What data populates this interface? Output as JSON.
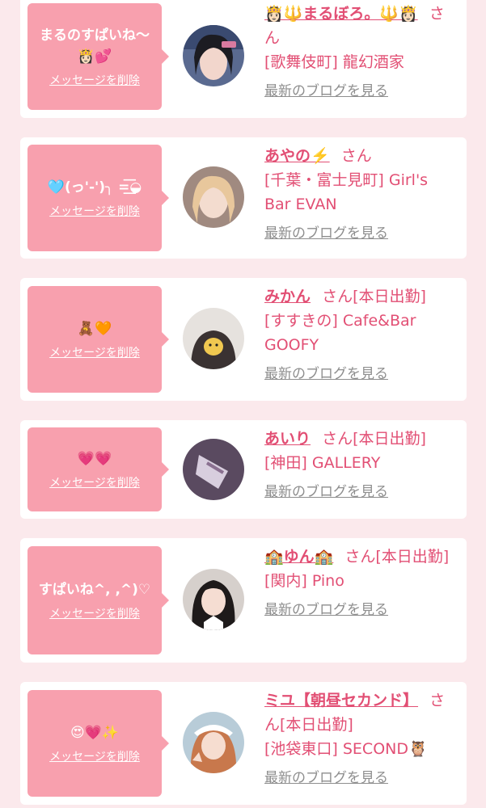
{
  "colors": {
    "page_bg": "#fbe9ec",
    "card_bg": "#ffffff",
    "bubble": "#f8a0ae",
    "accent": "#e24f74",
    "link_gray": "#8e8e8e"
  },
  "delete_label": "メッセージを削除",
  "blog_label": "最新のブログを見る",
  "san_label": "さん",
  "items": [
    {
      "message": "まるのすぱいね〜👸🏻💕",
      "name": "👸🏻🔱まるぼろ。🔱👸🏻",
      "status": "",
      "shop": "[歌舞伎町] 龍幻酒家"
    },
    {
      "message": "🩵(っ'-')╮ =͟͟͞͞◒",
      "name": "あやの⚡️",
      "status": "",
      "shop": "[千葉・富士見町] Girl's Bar EVAN"
    },
    {
      "message": "🧸🧡",
      "name": "みかん",
      "status": "[本日出勤]",
      "shop": "[すすきの] Cafe&Bar GOOFY"
    },
    {
      "message": "💗💗",
      "name": "あいり",
      "status": "[本日出勤]",
      "shop": "[神田] GALLERY"
    },
    {
      "message": "すぱいね^,  ,^)♡",
      "name": "🏫ゆん🏫",
      "status": "[本日出勤]",
      "shop": "[関内] Pino"
    },
    {
      "message": "😍💗✨",
      "name": "ミユ【朝昼セカンド】",
      "status": "[本日出勤]",
      "shop": "[池袋東口] SECOND🦉"
    }
  ]
}
